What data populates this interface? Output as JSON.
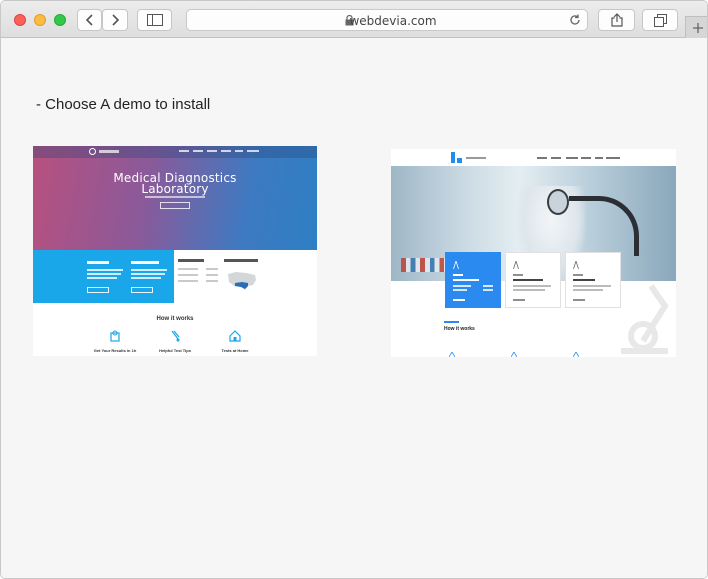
{
  "browser": {
    "url": "webdevia.com",
    "icons": [
      "back-icon",
      "forward-icon",
      "sidebar-icon",
      "lock-icon",
      "reload-icon",
      "share-icon",
      "tabs-icon",
      "plus-icon"
    ]
  },
  "page": {
    "heading": "- Choose A demo to install"
  },
  "demo1": {
    "title_line1": "Medical Diagnostics",
    "title_line2": "Laboratory",
    "how_it_works": "How it works",
    "features": [
      "Get Your Results in 1h",
      "Helpful Test Tips",
      "Tests at Home"
    ]
  },
  "demo2": {
    "how_it_works": "How it works"
  },
  "colors": {
    "demo1_blue": "#1aa7ea",
    "demo2_blue": "#2a8af0"
  }
}
